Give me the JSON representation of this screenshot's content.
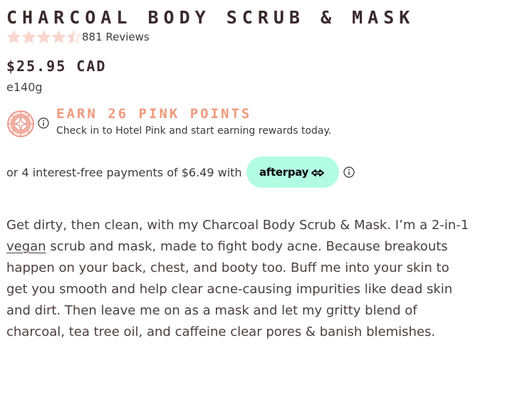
{
  "product": {
    "title": "CHARCOAL BODY SCRUB & MASK",
    "rating": {
      "value": 4.5,
      "max": 5,
      "reviews_label": "881 Reviews"
    },
    "price": "$25.95 CAD",
    "size": "e140g"
  },
  "rewards": {
    "heading": "EARN 26 PINK POINTS",
    "subtext": "Check in to Hotel Pink and start earning rewards today.",
    "badge_icon": "hotel-pink-badge-icon",
    "info_icon": "info-icon",
    "accent_color": "#f09a7d"
  },
  "afterpay": {
    "text": "or 4 interest-free payments of $6.49 with",
    "badge_label": "afterpay",
    "badge_color": "#b2fce4",
    "info_icon": "info-icon"
  },
  "description": {
    "part1": "Get dirty, then clean, with my Charcoal Body Scrub & Mask. I’m a 2-in-1 ",
    "link": "vegan",
    "part2": " scrub and mask, made to fight body acne. Because breakouts happen on your back, chest, and booty too. Buff me into your skin to get you smooth and help clear acne-causing impurities like dead skin and dirt. Then leave me on as a mask and let my gritty blend of charcoal, tea tree oil, and caffeine clear pores & banish blemishes."
  },
  "colors": {
    "star": "#f8d6cc",
    "text": "#3a2a2c"
  }
}
